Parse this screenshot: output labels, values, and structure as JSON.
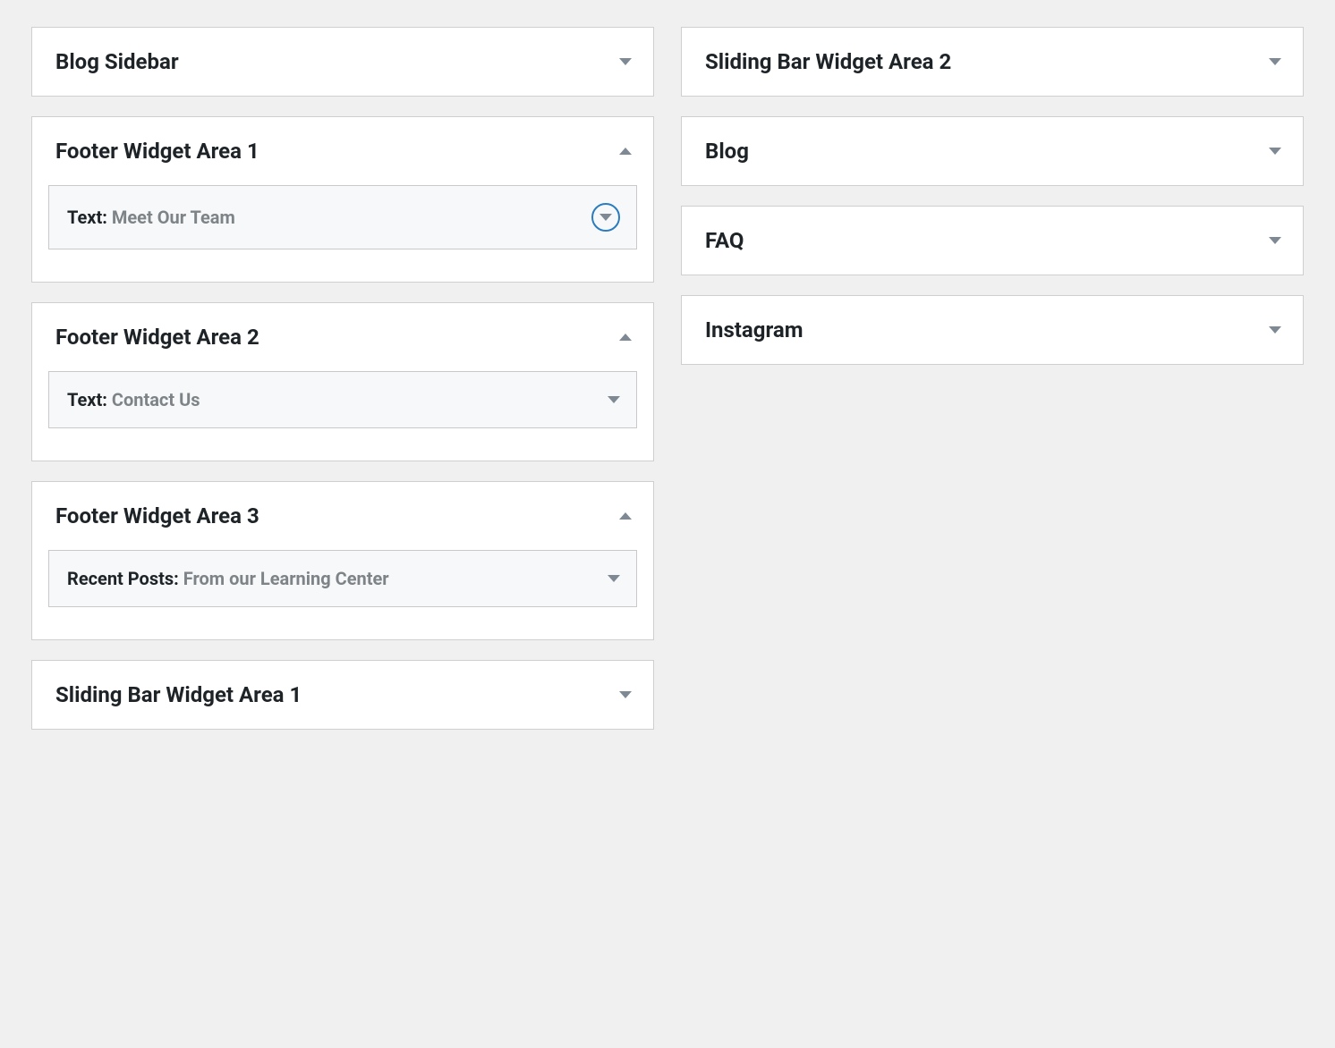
{
  "leftColumn": [
    {
      "title": "Blog Sidebar",
      "expanded": false
    },
    {
      "title": "Footer Widget Area 1",
      "expanded": true,
      "widgets": [
        {
          "type": "Text",
          "label": "Meet Our Team",
          "highlighted": true
        }
      ]
    },
    {
      "title": "Footer Widget Area 2",
      "expanded": true,
      "widgets": [
        {
          "type": "Text",
          "label": "Contact Us",
          "highlighted": false
        }
      ]
    },
    {
      "title": "Footer Widget Area 3",
      "expanded": true,
      "widgets": [
        {
          "type": "Recent Posts",
          "label": "From our Learning Center",
          "highlighted": false
        }
      ]
    },
    {
      "title": "Sliding Bar Widget Area 1",
      "expanded": false
    }
  ],
  "rightColumn": [
    {
      "title": "Sliding Bar Widget Area 2",
      "expanded": false
    },
    {
      "title": "Blog",
      "expanded": false
    },
    {
      "title": "FAQ",
      "expanded": false
    },
    {
      "title": "Instagram",
      "expanded": false
    }
  ]
}
